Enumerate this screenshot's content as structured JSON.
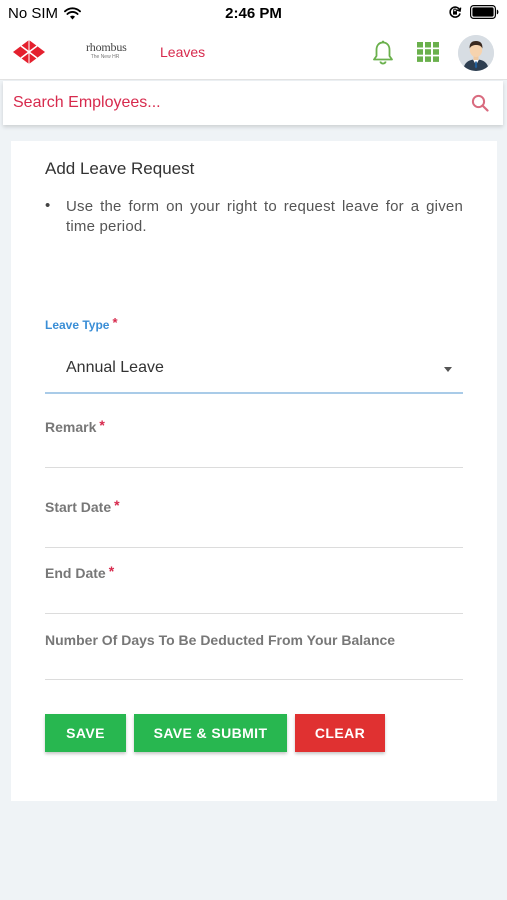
{
  "status_bar": {
    "carrier": "No SIM",
    "time": "2:46 PM",
    "icons": [
      "wifi-icon",
      "rotation-lock-icon",
      "battery-icon"
    ]
  },
  "header": {
    "brand_name": "rhombus",
    "brand_tagline": "The New HR",
    "nav_title": "Leaves",
    "icons": [
      "rhombus-logo-icon",
      "bell-icon",
      "apps-grid-icon",
      "avatar"
    ]
  },
  "search": {
    "placeholder": "Search Employees...",
    "icon": "search-icon"
  },
  "form": {
    "title": "Add Leave Request",
    "instruction": "Use the form on your right to request leave for a given time period.",
    "bullet": "•",
    "leave_type": {
      "label": "Leave Type",
      "required_mark": "*",
      "value": "Annual Leave"
    },
    "remark": {
      "label": "Remark",
      "required_mark": "*"
    },
    "start_date": {
      "label": "Start Date",
      "required_mark": "*"
    },
    "end_date": {
      "label": "End Date",
      "required_mark": "*"
    },
    "days_deducted": {
      "label": "Number Of Days To Be Deducted From Your Balance"
    }
  },
  "buttons": {
    "save": "SAVE",
    "save_submit": "SAVE & SUBMIT",
    "clear": "CLEAR"
  },
  "colors": {
    "accent": "#d72a4d",
    "primary_green": "#28b750",
    "danger_red": "#e03131",
    "label_blue": "#3a8ed6",
    "header_icon_green": "#6ab04c",
    "page_background": "#eff3f6"
  }
}
